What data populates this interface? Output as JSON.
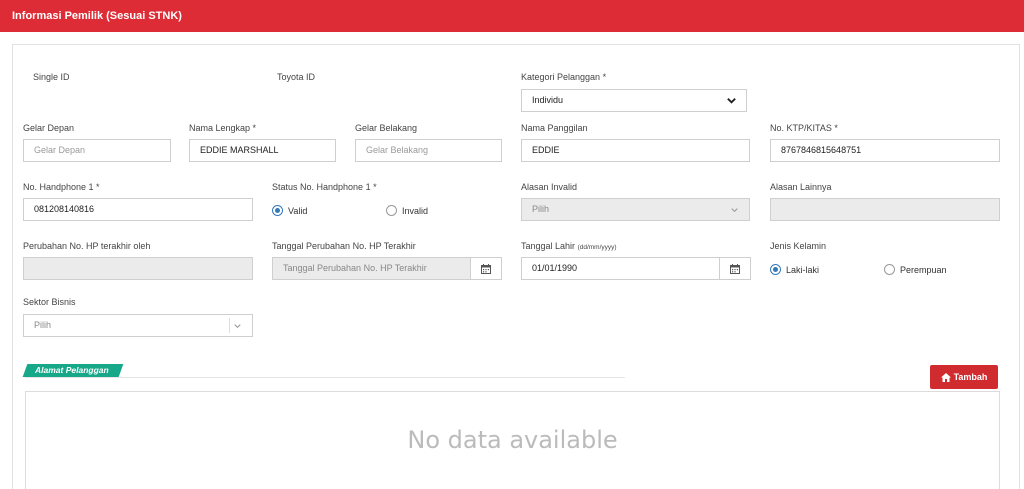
{
  "header": {
    "title": "Informasi Pemilik (Sesuai STNK)"
  },
  "form": {
    "single_id": {
      "label": "Single ID"
    },
    "toyota_id": {
      "label": "Toyota ID"
    },
    "kategori": {
      "label": "Kategori Pelanggan *",
      "value": "Individu"
    },
    "gelar_depan": {
      "label": "Gelar Depan",
      "placeholder": "Gelar Depan"
    },
    "nama_lengkap": {
      "label": "Nama Lengkap *",
      "value": "EDDIE MARSHALL"
    },
    "gelar_belakang": {
      "label": "Gelar Belakang",
      "placeholder": "Gelar Belakang"
    },
    "nama_panggilan": {
      "label": "Nama Panggilan",
      "value": "EDDIE"
    },
    "ktp": {
      "label": "No. KTP/KITAS *",
      "value": "8767846815648751"
    },
    "handphone": {
      "label": "No. Handphone 1 *",
      "value": "081208140816"
    },
    "status_hp": {
      "label": "Status No. Handphone 1 *",
      "options": [
        "Valid",
        "Invalid"
      ],
      "selected": "Valid"
    },
    "alasan_invalid": {
      "label": "Alasan Invalid",
      "value": "Pilih"
    },
    "alasan_lainnya": {
      "label": "Alasan Lainnya"
    },
    "perubahan_hp_oleh": {
      "label": "Perubahan No. HP terakhir oleh"
    },
    "tanggal_perubahan_hp": {
      "label": "Tanggal Perubahan No. HP Terakhir",
      "placeholder": "Tanggal Perubahan No. HP Terakhir"
    },
    "tanggal_lahir": {
      "label": "Tanggal Lahir",
      "hint": "(dd/mm/yyyy)",
      "value": "01/01/1990"
    },
    "jenis_kelamin": {
      "label": "Jenis Kelamin",
      "options": [
        "Laki-laki",
        "Perempuan"
      ],
      "selected": "Laki-laki"
    },
    "sektor_bisnis": {
      "label": "Sektor Bisnis",
      "value": "Pilih"
    }
  },
  "alamat": {
    "section_label": "Alamat Pelanggan",
    "add_button": "Tambah",
    "empty_text": "No data available"
  },
  "colors": {
    "header": "#dd2c35",
    "section_tag": "#17a889",
    "add_button": "#d02b2f",
    "radio_on": "#337ab7"
  }
}
